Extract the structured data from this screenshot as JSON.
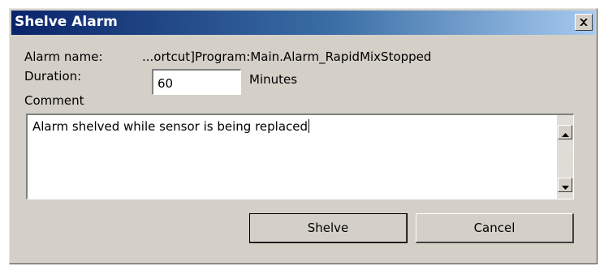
{
  "window": {
    "title": "Shelve Alarm"
  },
  "form": {
    "alarm_name_label": "Alarm name:",
    "alarm_name_value": "...ortcut]Program:Main.Alarm_RapidMixStopped",
    "duration_label": "Duration:",
    "duration_value": "60",
    "duration_unit": "Minutes",
    "comment_label": "Comment",
    "comment_value": "Alarm shelved while sensor is being replaced"
  },
  "buttons": {
    "shelve_label": "Shelve",
    "cancel_label": "Cancel"
  },
  "icons": {
    "close": "close-icon",
    "scroll_up": "scroll-up-arrow-icon",
    "scroll_down": "scroll-down-arrow-icon"
  },
  "colors": {
    "titlebar_start": "#0a246a",
    "titlebar_end": "#a6caf0",
    "dialog_bg": "#d4d0c8"
  }
}
